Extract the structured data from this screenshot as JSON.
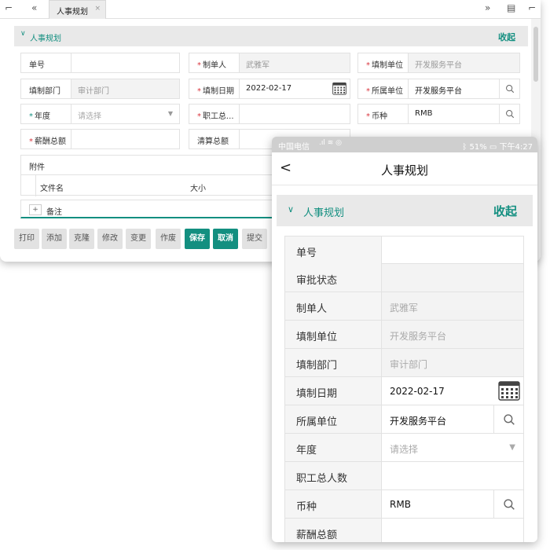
{
  "desktop": {
    "tab_label": "人事规划",
    "tab_close": "×",
    "section": {
      "title": "人事规划",
      "collapse": "收起"
    },
    "fields": [
      {
        "label": "单号",
        "value": "",
        "req": "",
        "state": "edit"
      },
      {
        "label": "制单人",
        "value": "武雅军",
        "req": "*",
        "state": "ro"
      },
      {
        "label": "填制单位",
        "value": "开发服务平台",
        "req": "*",
        "state": "ro"
      },
      {
        "label": "填制部门",
        "value": "审计部门",
        "req": "",
        "state": "ro"
      },
      {
        "label": "填制日期",
        "value": "2022-02-17",
        "req": "*",
        "state": "edit"
      },
      {
        "label": "所属单位",
        "value": "开发服务平台",
        "req": "*",
        "state": "edit"
      },
      {
        "label": "年度",
        "value": "请选择",
        "req": "*",
        "state": "ph"
      },
      {
        "label": "职工总...",
        "value": "",
        "req": "*",
        "state": "edit"
      },
      {
        "label": "币种",
        "value": "RMB",
        "req": "*",
        "state": "edit"
      },
      {
        "label": "薪酬总额",
        "value": "",
        "req": "*",
        "state": "edit"
      },
      {
        "label": "清算总额",
        "value": "",
        "req": "",
        "state": "edit"
      }
    ],
    "attachment": {
      "title": "附件",
      "columns": [
        "文件名",
        "大小"
      ]
    },
    "note": {
      "plus": "+",
      "label": "备注"
    },
    "buttons": [
      "打印",
      "添加",
      "克隆",
      "修改",
      "变更",
      "作废",
      "保存",
      "取消",
      "提交"
    ]
  },
  "phone": {
    "status": {
      "carrier": "中国电信",
      "battery": "51%",
      "time": "下午4:27"
    },
    "title": "人事规划",
    "section": {
      "title": "人事规划",
      "collapse": "收起"
    },
    "rows": [
      {
        "label": "单号",
        "value": "",
        "req": "",
        "state": "edit"
      },
      {
        "label": "审批状态",
        "value": "",
        "req": "",
        "state": "ro"
      },
      {
        "label": "制单人",
        "value": "武雅军",
        "req": "*",
        "state": "ro"
      },
      {
        "label": "填制单位",
        "value": "开发服务平台",
        "req": "*",
        "state": "ro"
      },
      {
        "label": "填制部门",
        "value": "审计部门",
        "req": "",
        "state": "ro"
      },
      {
        "label": "填制日期",
        "value": "2022-02-17",
        "req": "*",
        "state": "edit"
      },
      {
        "label": "所属单位",
        "value": "开发服务平台",
        "req": "*",
        "state": "edit"
      },
      {
        "label": "年度",
        "value": "请选择",
        "req": "*",
        "state": "ph"
      },
      {
        "label": "职工总人数",
        "value": "",
        "req": "*",
        "state": "edit"
      },
      {
        "label": "币种",
        "value": "RMB",
        "req": "*",
        "state": "edit"
      },
      {
        "label": "薪酬总额",
        "value": "",
        "req": "*",
        "state": "edit"
      }
    ]
  },
  "colors": {
    "accent": "#138f80",
    "required": "#d9343d"
  }
}
